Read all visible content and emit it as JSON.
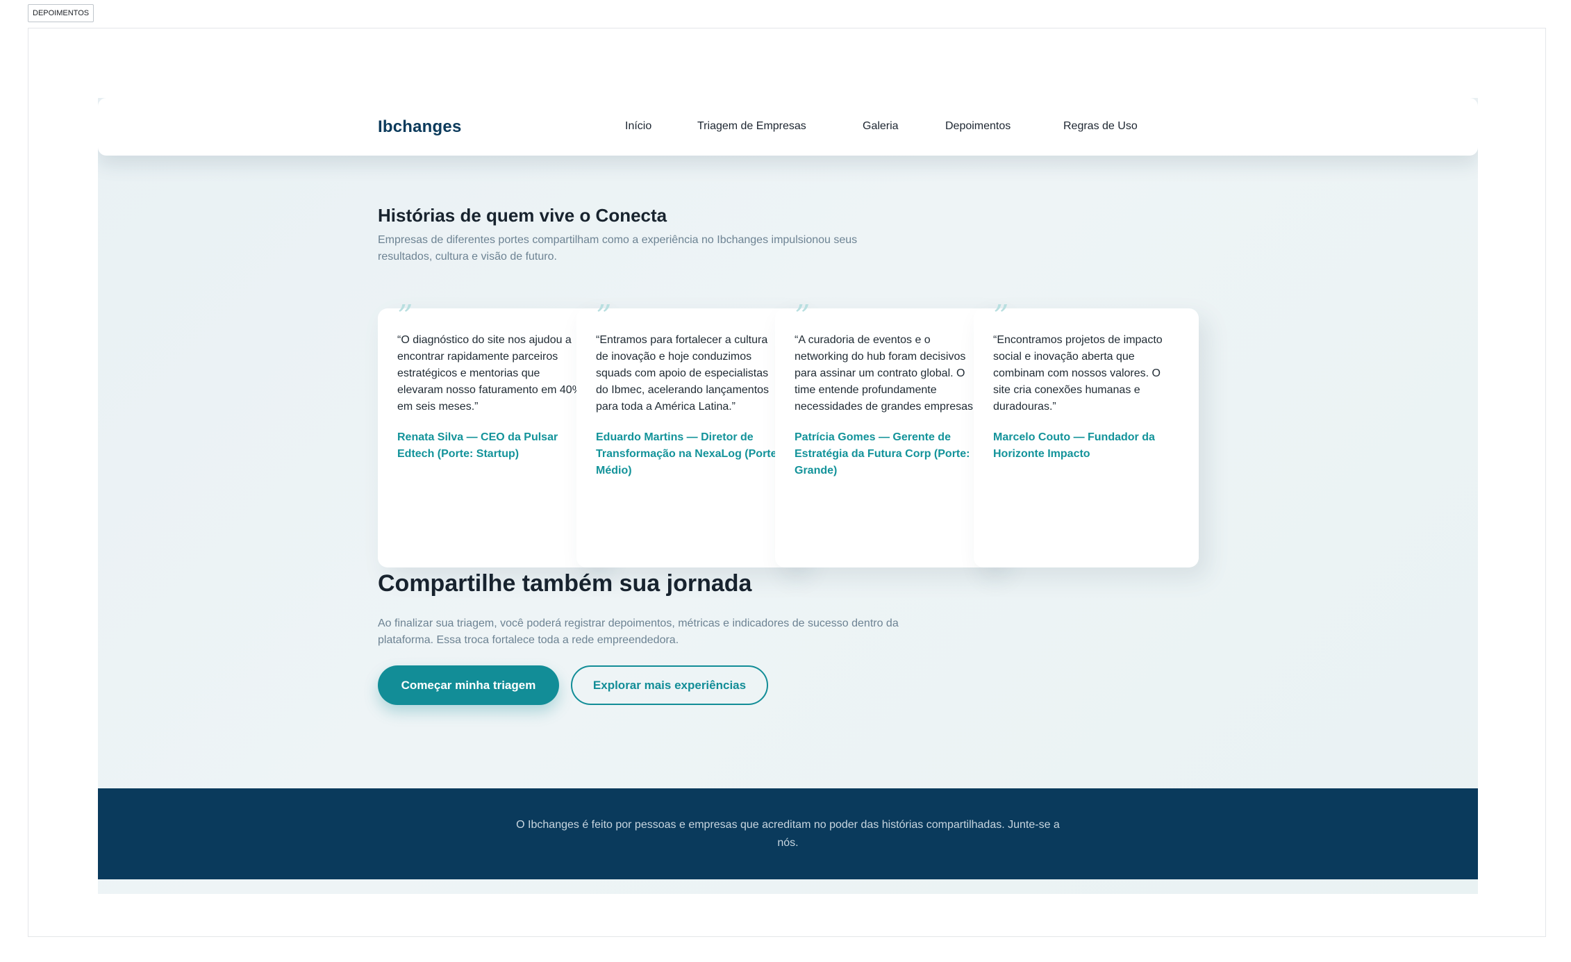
{
  "frame_label": "DEPOIMENTOS",
  "colors": {
    "brand": "#0b3a5b",
    "accent": "#128d97",
    "footer_bg": "#0a3a5c",
    "page_bg": "#e9f1f4"
  },
  "header": {
    "brand": "Ibchanges",
    "nav": [
      "Início",
      "Triagem de Empresas",
      "Galeria",
      "Depoimentos",
      "Regras de Uso"
    ]
  },
  "hero": {
    "title": "Histórias de quem vive o Conecta",
    "subtitle": "Empresas de diferentes portes compartilham como a experiência no Ibchanges impulsionou seus resultados, cultura e visão de futuro."
  },
  "testimonials": [
    {
      "quote": "“O diagnóstico do site nos ajudou a encontrar rapidamente parceiros estratégicos e mentorias que elevaram nosso faturamento em 40% em seis meses.”",
      "author": "Renata Silva — CEO da Pulsar Edtech (Porte: Startup)"
    },
    {
      "quote": "“Entramos para fortalecer a cultura de inovação e hoje conduzimos squads com apoio de especialistas do Ibmec, acelerando lançamentos para toda a América Latina.”",
      "author": "Eduardo Martins — Diretor de Transformação na NexaLog (Porte: Médio)"
    },
    {
      "quote": "“A curadoria de eventos e o networking do hub foram decisivos para assinar um contrato global. O time entende profundamente necessidades de grandes empresas.”",
      "author": "Patrícia Gomes — Gerente de Estratégia da Futura Corp (Porte: Grande)"
    },
    {
      "quote": "“Encontramos projetos de impacto social e inovação aberta que combinam com nossos valores. O site cria conexões humanas e duradouras.”",
      "author": "Marcelo Couto — Fundador da Horizonte Impacto"
    }
  ],
  "quote_icon": "quote-icon",
  "share": {
    "title": "Compartilhe também sua jornada",
    "subtitle": "Ao finalizar sua triagem, você poderá registrar depoimentos, métricas e indicadores de sucesso dentro da plataforma. Essa troca fortalece toda a rede empreendedora.",
    "primary_button": "Começar minha triagem",
    "secondary_button": "Explorar mais experiências"
  },
  "footer": {
    "text": "O Ibchanges é feito por pessoas e empresas que acreditam no poder das histórias compartilhadas. Junte-se a nós."
  }
}
